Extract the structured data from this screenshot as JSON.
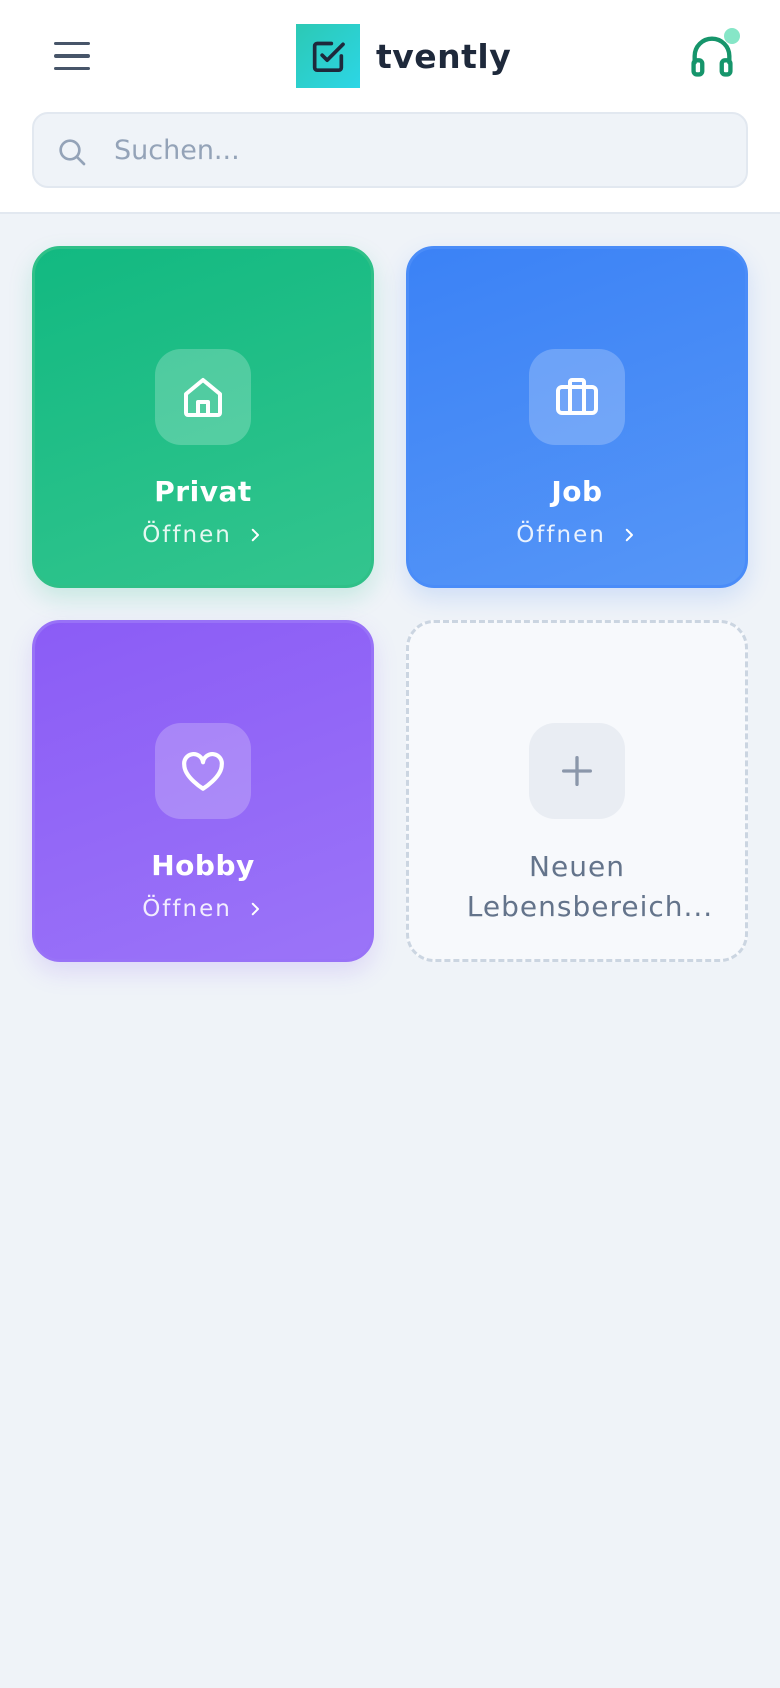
{
  "header": {
    "brand_name": "tvently",
    "search_placeholder": "Suchen...",
    "support_status_color": "#86e6c7",
    "icons": {
      "menu": "hamburger-icon",
      "logo": "checkbox-check-icon",
      "support": "headset-icon",
      "search": "search-icon"
    }
  },
  "areas": [
    {
      "title": "Privat",
      "action": "Öffnen",
      "icon": "home-icon",
      "color": "#12b981"
    },
    {
      "title": "Job",
      "action": "Öffnen",
      "icon": "briefcase-icon",
      "color": "#3b82f6"
    },
    {
      "title": "Hobby",
      "action": "Öffnen",
      "icon": "heart-icon",
      "color": "#8b5cf6"
    }
  ],
  "add_area": {
    "label_line1": "Neuen",
    "label_line2": "Lebensbereich...",
    "icon": "plus-icon"
  }
}
